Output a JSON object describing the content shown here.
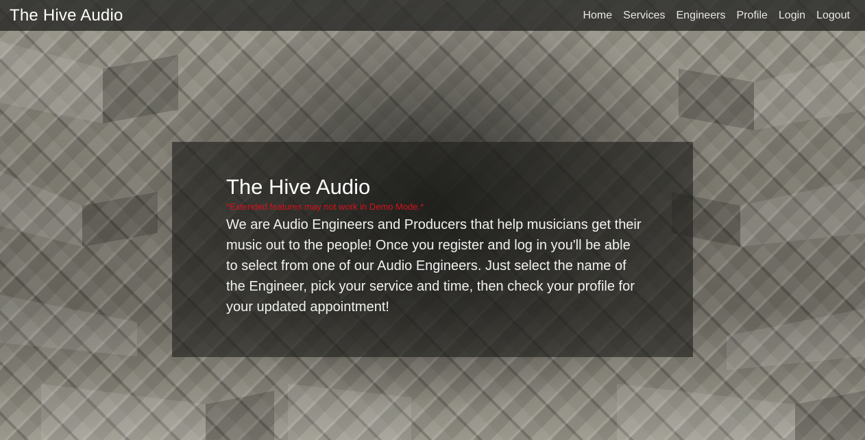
{
  "navbar": {
    "brand": "The Hive Audio",
    "links": [
      {
        "label": "Home"
      },
      {
        "label": "Services"
      },
      {
        "label": "Engineers"
      },
      {
        "label": "Profile"
      },
      {
        "label": "Login"
      },
      {
        "label": "Logout"
      }
    ]
  },
  "hero": {
    "title": "The Hive Audio",
    "note": "*Extended features may not work in Demo Mode.*",
    "text": "We are Audio Engineers and Producers that help musicians get their music out to the people! Once you register and log in you'll be able to select from one of our Audio Engineers. Just select the name of the Engineer, pick your service and time, then check your profile for your updated appointment!"
  },
  "colors": {
    "note": "#d6121c",
    "navbar_bg": "#282826",
    "hero_bg": "#1e1e1c"
  }
}
